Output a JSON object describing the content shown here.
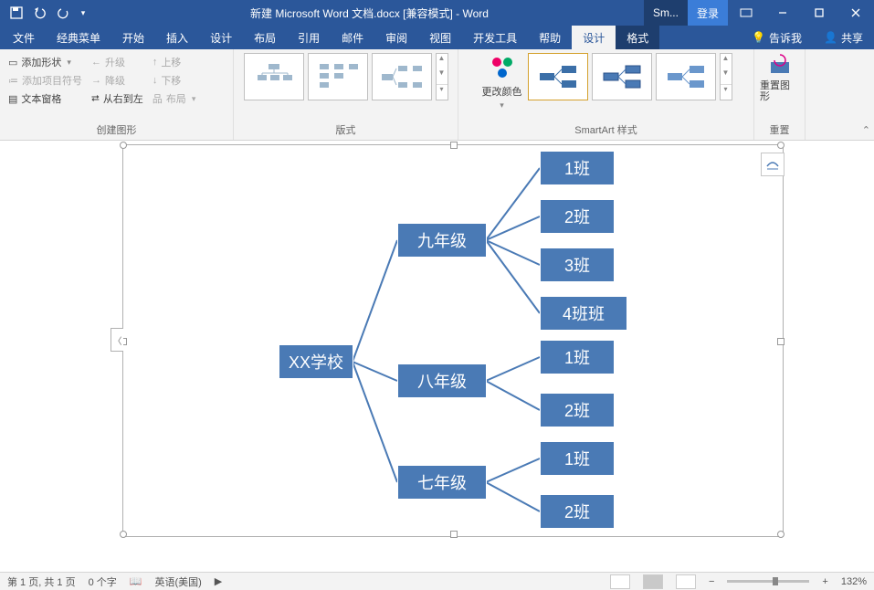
{
  "title": "新建 Microsoft Word 文档.docx [兼容模式] - Word",
  "account": {
    "short": "Sm...",
    "login": "登录"
  },
  "tabs": [
    "文件",
    "经典菜单",
    "开始",
    "插入",
    "设计",
    "布局",
    "引用",
    "邮件",
    "审阅",
    "视图",
    "开发工具",
    "帮助",
    "设计",
    "格式"
  ],
  "tabs_active_index": 12,
  "tabs_right": {
    "tellme": "告诉我",
    "share": "共享"
  },
  "ribbon": {
    "group1": {
      "label": "创建图形",
      "add_shape": "添加形状",
      "add_bullet": "添加项目符号",
      "text_pane": "文本窗格",
      "promote": "升级",
      "demote": "降级",
      "rtl": "从右到左",
      "move_up": "上移",
      "move_down": "下移",
      "layout": "布局"
    },
    "group2": {
      "label": "版式"
    },
    "group3": {
      "label": "SmartArt 样式",
      "change_colors": "更改颜色"
    },
    "group4": {
      "label": "重置",
      "reset": "重置图形"
    }
  },
  "smartart": {
    "root": "XX学校",
    "grades": [
      {
        "name": "九年级",
        "classes": [
          "1班",
          "2班",
          "3班",
          "4班班"
        ]
      },
      {
        "name": "八年级",
        "classes": [
          "1班",
          "2班"
        ]
      },
      {
        "name": "七年级",
        "classes": [
          "1班",
          "2班"
        ]
      }
    ]
  },
  "status": {
    "page": "第 1 页, 共 1 页",
    "words": "0 个字",
    "lang": "英语(美国)",
    "zoom": "132%"
  },
  "colors": {
    "brand": "#2b579a",
    "node": "#4a7ab5"
  }
}
